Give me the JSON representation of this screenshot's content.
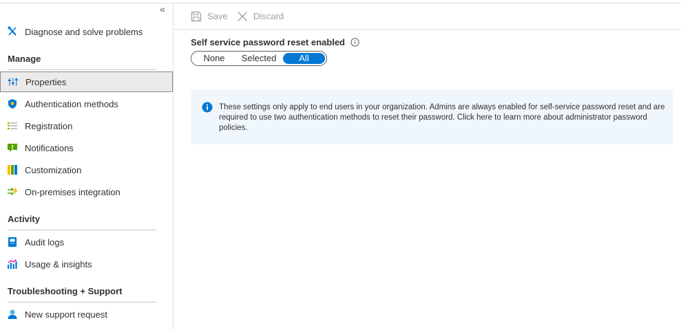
{
  "toolbar": {
    "save_label": "Save",
    "discard_label": "Discard"
  },
  "sidebar": {
    "collapse_glyph": "«",
    "top_items": [
      {
        "label": "Diagnose and solve problems",
        "icon": "wrench-icon"
      }
    ],
    "sections": [
      {
        "title": "Manage",
        "items": [
          {
            "label": "Properties",
            "icon": "properties-icon",
            "selected": true
          },
          {
            "label": "Authentication methods",
            "icon": "shield-icon"
          },
          {
            "label": "Registration",
            "icon": "list-icon"
          },
          {
            "label": "Notifications",
            "icon": "notification-icon"
          },
          {
            "label": "Customization",
            "icon": "customization-icon"
          },
          {
            "label": "On-premises integration",
            "icon": "sync-icon"
          }
        ]
      },
      {
        "title": "Activity",
        "items": [
          {
            "label": "Audit logs",
            "icon": "book-icon"
          },
          {
            "label": "Usage & insights",
            "icon": "chart-icon"
          }
        ]
      },
      {
        "title": "Troubleshooting + Support",
        "items": [
          {
            "label": "New support request",
            "icon": "person-icon"
          }
        ]
      }
    ]
  },
  "main": {
    "sspr_label": "Self service password reset enabled",
    "toggle": {
      "options": [
        "None",
        "Selected",
        "All"
      ],
      "selected": "All"
    },
    "info_text": "These settings only apply to end users in your organization. Admins are always enabled for self-service password reset and are required to use two authentication methods to reset their password. Click here to learn more about administrator password policies."
  },
  "colors": {
    "accent": "#0078d4",
    "banner_bg": "#eff6fc",
    "selected_bg": "#edebe9"
  }
}
